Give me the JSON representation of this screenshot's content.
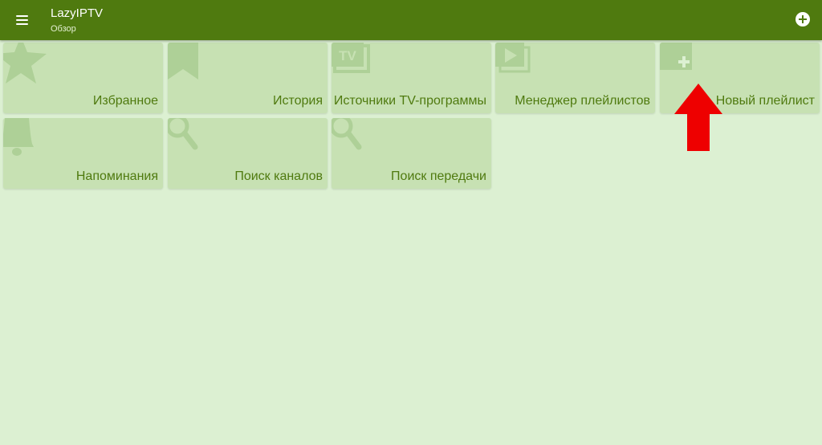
{
  "appbar": {
    "title": "LazyIPTV",
    "subtitle": "Обзор",
    "menu_icon": "hamburger-menu-icon",
    "add_icon": "add-circle-icon"
  },
  "tiles": [
    {
      "label": "Избранное",
      "icon": "star-icon"
    },
    {
      "label": "История",
      "icon": "bookmark-icon"
    },
    {
      "label": "Источники TV-программы",
      "icon": "tv-icon",
      "icon_text": "TV"
    },
    {
      "label": "Менеджер плейлистов",
      "icon": "playlist-play-icon"
    },
    {
      "label": "Новый плейлист",
      "icon": "playlist-add-icon"
    },
    {
      "label": "Напоминания",
      "icon": "bell-icon"
    },
    {
      "label": "Поиск каналов",
      "icon": "search-icon"
    },
    {
      "label": "Поиск передачи",
      "icon": "search-icon"
    }
  ],
  "colors": {
    "appbar": "#4f7a0f",
    "background": "#dcf0d2",
    "tile": "#c7e1b3",
    "tile_icon": "#aed097",
    "tile_text": "#4f7a0f",
    "annotation_arrow": "#ee0000"
  },
  "annotation": {
    "icon": "red-arrow-up-icon",
    "points_to": "Новый плейлист"
  }
}
